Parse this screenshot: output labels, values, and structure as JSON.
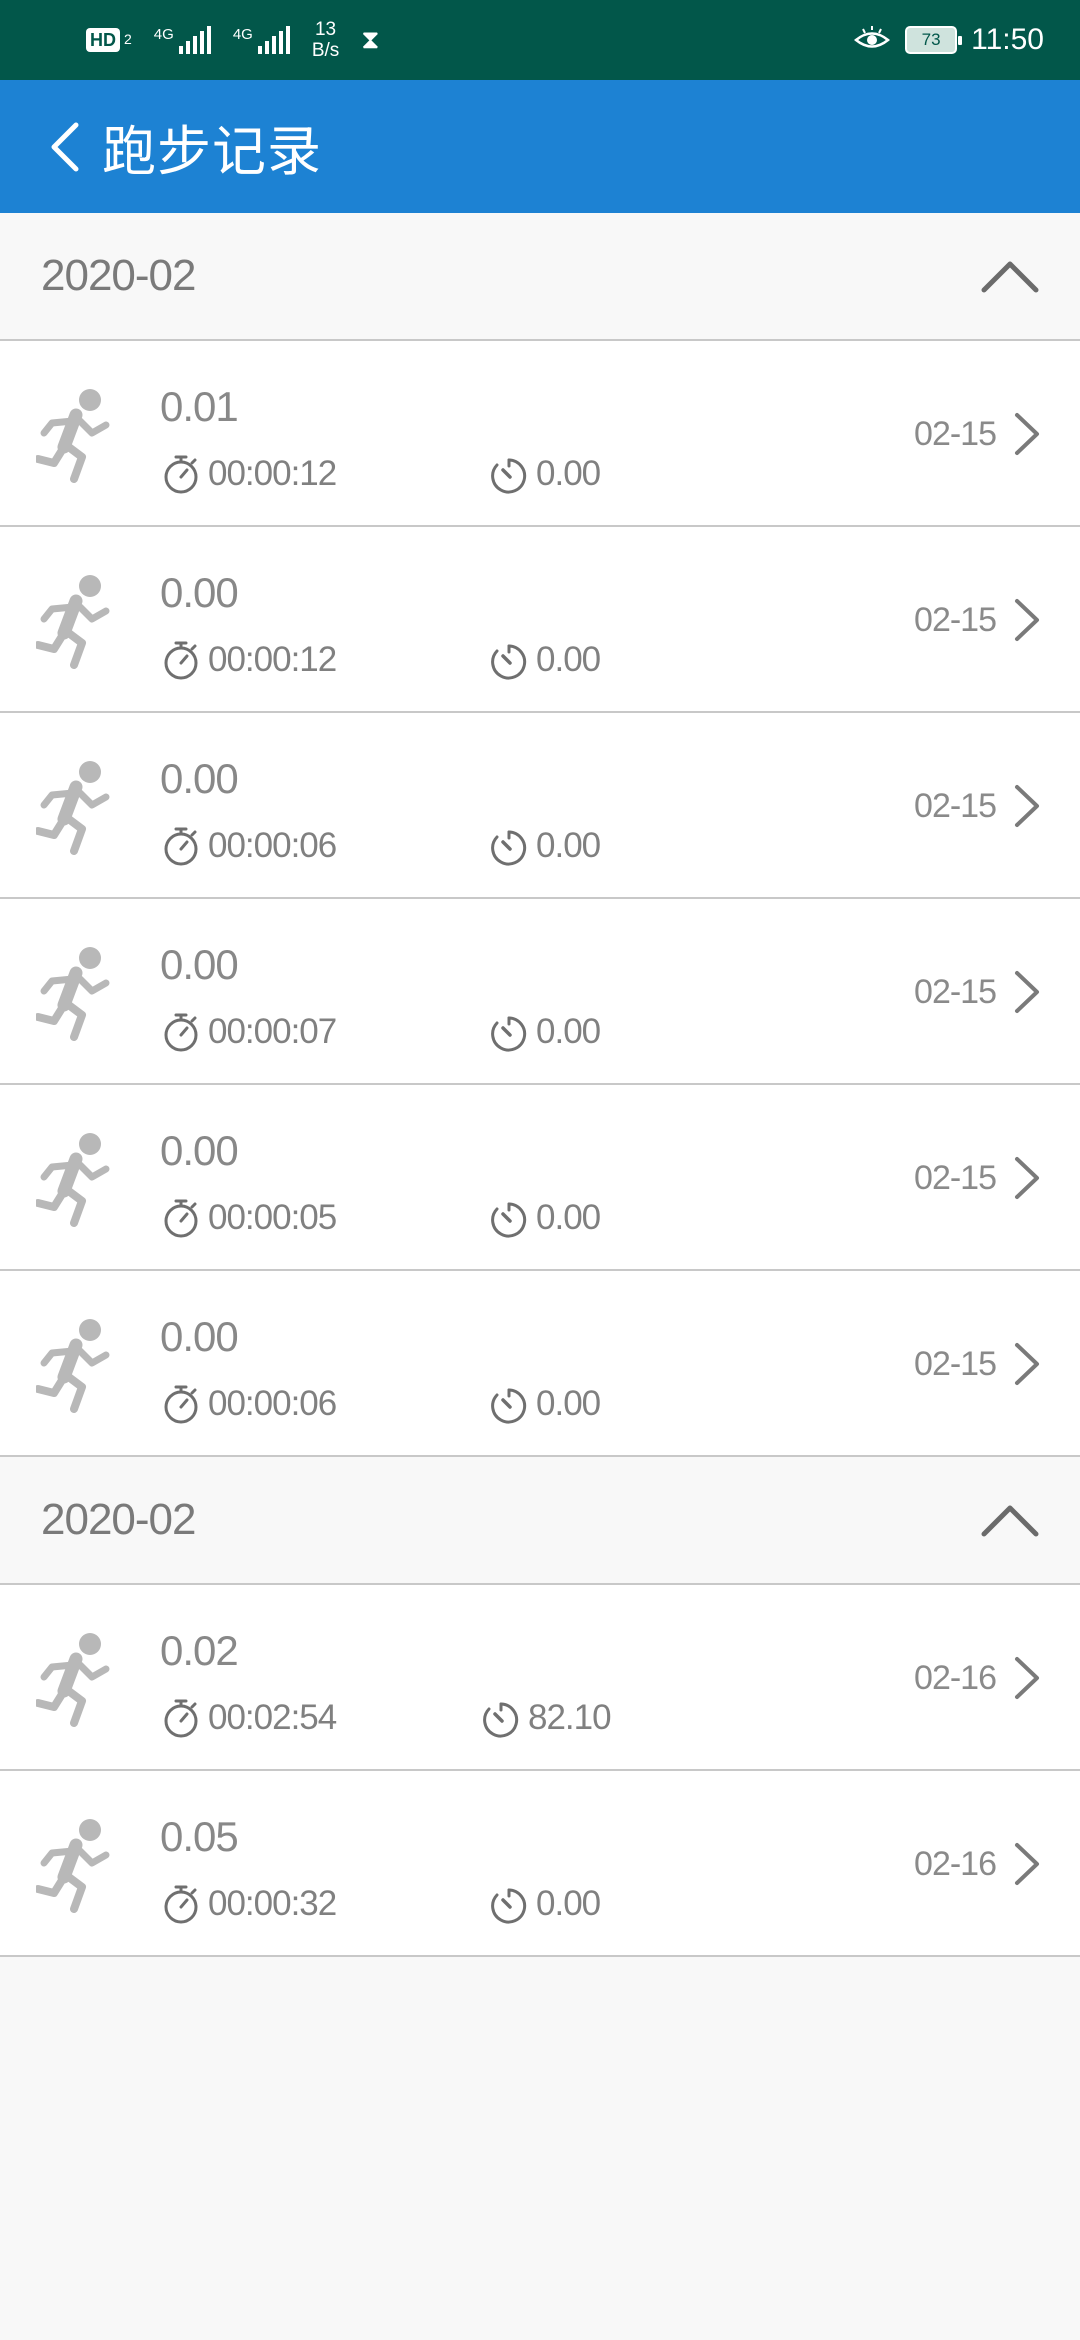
{
  "status_bar": {
    "hd_label": "HD",
    "sim_number": "2",
    "signal1_label": "4G",
    "signal2_label": "4G",
    "net_speed_value": "13",
    "net_speed_unit": "B/s",
    "battery_level": "73",
    "time": "11:50",
    "background_color": "#02574a"
  },
  "header": {
    "title": "跑步记录",
    "background_color": "#1d82d3"
  },
  "sections": [
    {
      "title": "2020-02",
      "records": [
        {
          "distance": "0.01",
          "duration": "00:00:12",
          "pace": "0.00",
          "date": "02-15"
        },
        {
          "distance": "0.00",
          "duration": "00:00:12",
          "pace": "0.00",
          "date": "02-15"
        },
        {
          "distance": "0.00",
          "duration": "00:00:06",
          "pace": "0.00",
          "date": "02-15"
        },
        {
          "distance": "0.00",
          "duration": "00:00:07",
          "pace": "0.00",
          "date": "02-15"
        },
        {
          "distance": "0.00",
          "duration": "00:00:05",
          "pace": "0.00",
          "date": "02-15"
        },
        {
          "distance": "0.00",
          "duration": "00:00:06",
          "pace": "0.00",
          "date": "02-15"
        }
      ]
    },
    {
      "title": "2020-02",
      "records": [
        {
          "distance": "0.02",
          "duration": "00:02:54",
          "pace": "82.10",
          "date": "02-16"
        },
        {
          "distance": "0.05",
          "duration": "00:00:32",
          "pace": "0.00",
          "date": "02-16"
        }
      ]
    }
  ],
  "icons": {
    "back": "chevron-left-icon",
    "collapse": "chevron-up-icon",
    "row": "runner-icon",
    "duration": "stopwatch-icon",
    "pace": "timer-icon",
    "open": "chevron-right-icon"
  }
}
